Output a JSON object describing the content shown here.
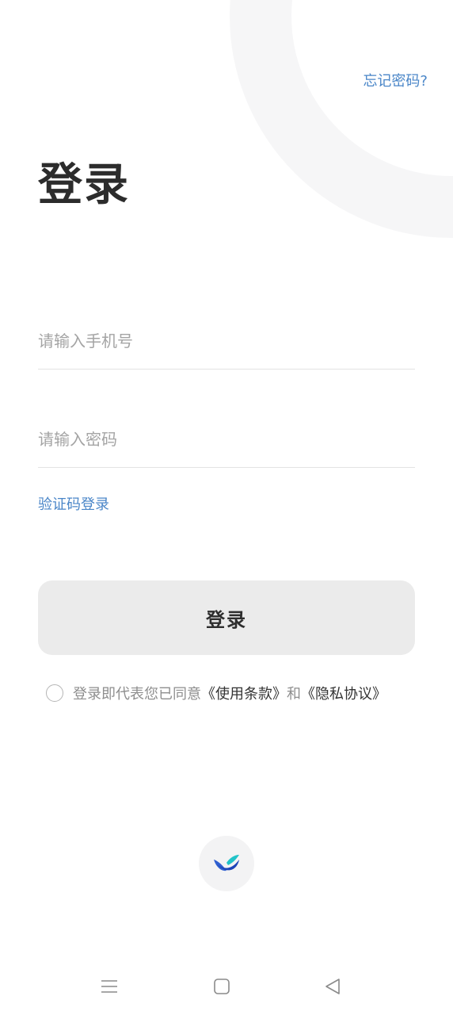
{
  "header": {
    "forgot_password": "忘记密码?"
  },
  "page": {
    "title": "登录"
  },
  "form": {
    "phone_placeholder": "请输入手机号",
    "password_placeholder": "请输入密码",
    "sms_login": "验证码登录",
    "login_button": "登录"
  },
  "agreement": {
    "checked": false,
    "prefix": "登录即代表您已同意",
    "terms": "《使用条款》",
    "conjunction": "和",
    "privacy": "《隐私协议》"
  },
  "colors": {
    "accent_link": "#4a86c8",
    "button_bg": "#ebebeb",
    "title_text": "#2c2c2c",
    "logo_blue": "#2f5fd0",
    "logo_teal": "#21c3c8"
  },
  "icons": {
    "logo": "bird-logo-icon",
    "nav_menu": "menu-icon",
    "nav_home": "home-square-icon",
    "nav_back": "back-triangle-icon"
  }
}
